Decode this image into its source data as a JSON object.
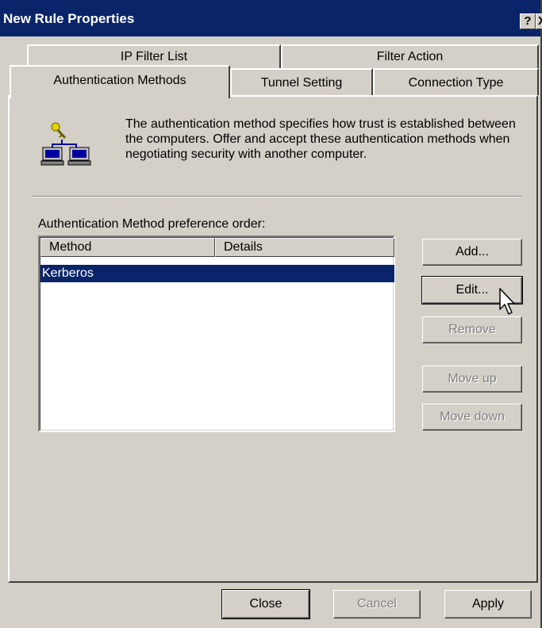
{
  "window": {
    "title": "New Rule Properties",
    "help_label": "?",
    "close_label": "X"
  },
  "tabs": {
    "back": [
      {
        "label": "IP Filter List"
      },
      {
        "label": "Filter Action"
      }
    ],
    "front": [
      {
        "label": "Authentication Methods",
        "selected": true
      },
      {
        "label": "Tunnel Setting"
      },
      {
        "label": "Connection Type"
      }
    ]
  },
  "panel": {
    "icon": "computers-key-icon",
    "description": "The authentication method specifies how trust is established between the computers. Offer and accept these authentication methods when negotiating security with another computer.",
    "list_label": "Authentication Method preference order:",
    "columns": [
      "Method",
      "Details"
    ],
    "rows": [
      {
        "method": "Kerberos",
        "details": "",
        "selected": true
      }
    ],
    "buttons": {
      "add": "Add...",
      "edit": "Edit...",
      "remove": "Remove",
      "move_up": "Move up",
      "move_down": "Move down"
    }
  },
  "footer": {
    "close": "Close",
    "cancel": "Cancel",
    "apply": "Apply"
  }
}
